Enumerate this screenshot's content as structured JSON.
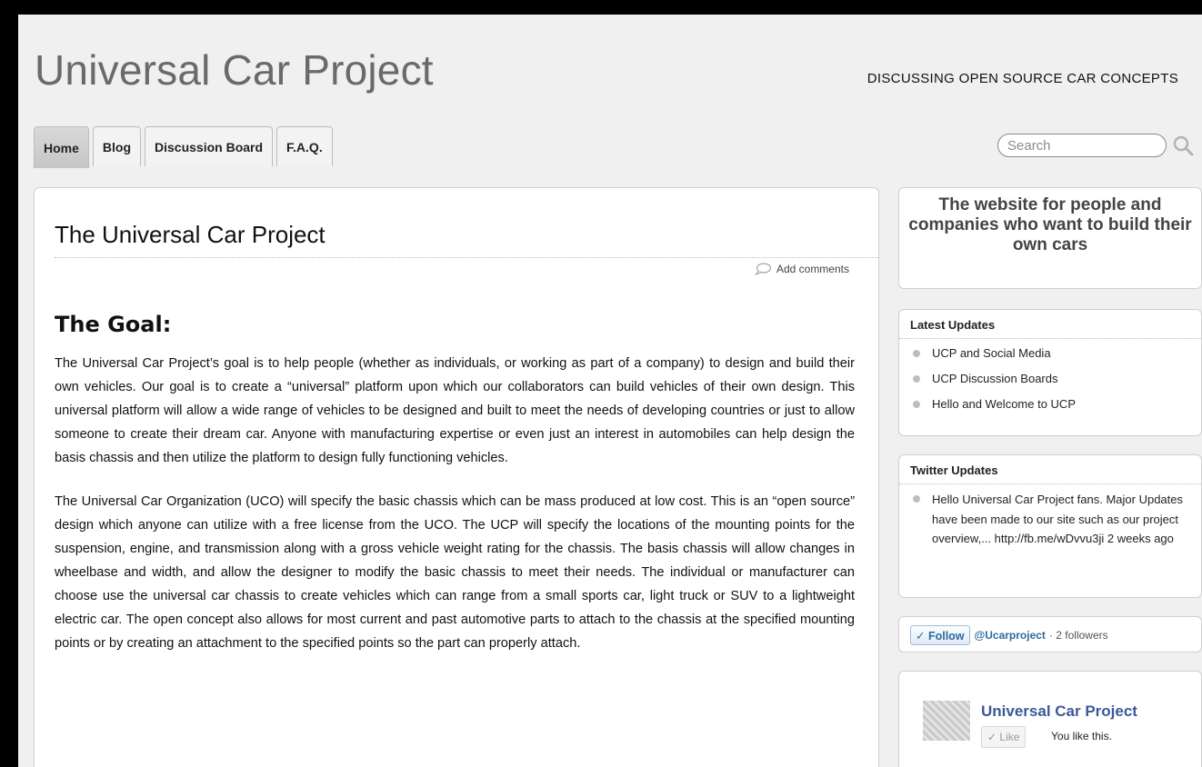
{
  "header": {
    "site_title": "Universal Car Project",
    "tagline": "DISCUSSING OPEN SOURCE CAR CONCEPTS"
  },
  "nav": {
    "tabs": [
      {
        "label": "Home",
        "active": true
      },
      {
        "label": "Blog"
      },
      {
        "label": "Discussion Board"
      },
      {
        "label": "F.A.Q."
      }
    ]
  },
  "search": {
    "placeholder": "Search"
  },
  "post": {
    "title": "The Universal Car Project",
    "comments_link": "Add comments",
    "heading": "The Goal:",
    "paragraphs": [
      "The Universal Car Project’s goal is to help people (whether as individuals, or working as part of a company) to design and build their own vehicles. Our goal is to create a “universal” platform upon which our collaborators can build vehicles of their own design. This universal platform will allow a wide range of vehicles to be designed and built to meet the needs of developing countries or just to allow someone to create their dream car. Anyone with manufacturing expertise or even just an interest in automobiles can help design the basis chassis and then utilize the platform to design fully functioning vehicles.",
      "The Universal Car Organization (UCO) will specify the basic chassis which can be mass produced at low cost. This is an “open source” design which anyone can utilize with a free license from the UCO. The UCP will specify the locations of the mounting points for the suspension, engine, and transmission along with a gross vehicle weight rating for the chassis. The basis chassis will allow changes in wheelbase and width, and allow the designer to modify the basic chassis to meet their needs. The individual or manufacturer can choose use the universal car chassis to create vehicles which can range from a small sports car, light truck or SUV to a lightweight electric car. The open concept also allows for most current and past automotive parts to attach to the chassis at the specified mounting points or by creating an attachment to the specified points so the part can properly attach."
    ]
  },
  "sidebar": {
    "promo": "The website for people and companies who want to build their own cars",
    "latest_updates": {
      "title": "Latest Updates",
      "items": [
        "UCP and Social Media",
        "UCP Discussion Boards",
        "Hello and Welcome to UCP"
      ]
    },
    "twitter_updates": {
      "title": "Twitter Updates",
      "items": [
        "Hello Universal Car Project fans. Major Updates have been made to our site such as our project overview,... http://fb.me/wDvvu3ji 2 weeks ago"
      ]
    },
    "follow": {
      "button": "✓ Follow",
      "handle": "@Ucarproject",
      "count": "· 2 followers"
    },
    "facebook": {
      "name": "Universal Car Project",
      "like_button": "✓ Like",
      "like_note": "You like this."
    }
  }
}
